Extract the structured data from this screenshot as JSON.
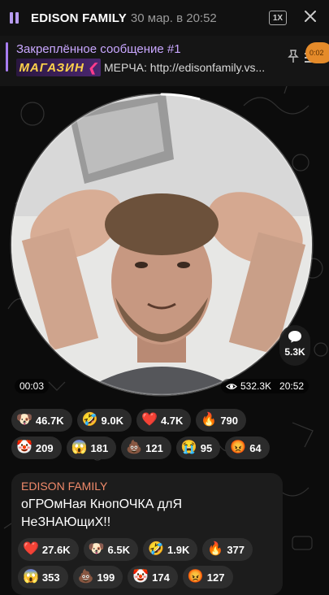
{
  "topbar": {
    "channel_title": "EDISON FAMILY",
    "date": "30 мар. в 20:52",
    "speed_label": "1X"
  },
  "pinned": {
    "title": "Закреплённое сообщение #1",
    "thumb_label": "МАГАЗИН",
    "text": "МЕРЧА: http://edisonfamily.vs...",
    "badge": "0:02"
  },
  "video": {
    "duration": "00:03",
    "views": "532.3K",
    "time": "20:52",
    "comments": "5.3K",
    "progress": 0.04
  },
  "reactions_row1": [
    {
      "emoji": "🐶",
      "count": "46.7K"
    },
    {
      "emoji": "🤣",
      "count": "9.0K"
    },
    {
      "emoji": "❤️",
      "count": "4.7K"
    },
    {
      "emoji": "🔥",
      "count": "790"
    }
  ],
  "reactions_row2": [
    {
      "emoji": "🤡",
      "count": "209"
    },
    {
      "emoji": "😱",
      "count": "181"
    },
    {
      "emoji": "💩",
      "count": "121"
    },
    {
      "emoji": "😭",
      "count": "95"
    },
    {
      "emoji": "😡",
      "count": "64"
    }
  ],
  "message": {
    "author": "EDISON FAMILY",
    "text": "оГРОмНая КнопОЧКА длЯ НеЗНАЮщиХ!!",
    "reactions_row1": [
      {
        "emoji": "❤️",
        "count": "27.6K"
      },
      {
        "emoji": "🐶",
        "count": "6.5K"
      },
      {
        "emoji": "🤣",
        "count": "1.9K"
      },
      {
        "emoji": "🔥",
        "count": "377"
      }
    ],
    "reactions_row2": [
      {
        "emoji": "😱",
        "count": "353"
      },
      {
        "emoji": "💩",
        "count": "199"
      },
      {
        "emoji": "🤡",
        "count": "174"
      },
      {
        "emoji": "😡",
        "count": "127"
      }
    ]
  },
  "colors": {
    "accent": "#a77df0",
    "author": "#f08a6a",
    "badge": "#e58b2a"
  }
}
